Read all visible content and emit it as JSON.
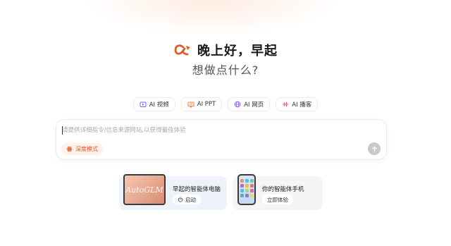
{
  "greeting": {
    "title": "晚上好，早起",
    "subtitle": "想做点什么?"
  },
  "chips": [
    {
      "icon": "video-icon",
      "label": "AI 视频"
    },
    {
      "icon": "ppt-icon",
      "label": "AI PPT"
    },
    {
      "icon": "globe-icon",
      "label": "AI 网页"
    },
    {
      "icon": "audio-wave-icon",
      "label": "AI 播客"
    }
  ],
  "input": {
    "placeholder": "请提供详细指令/信息来源网站,以获得最佳体验",
    "value": ""
  },
  "mode_button": {
    "label": "深度模式"
  },
  "cards": [
    {
      "title": "早起的智能体电脑",
      "thumb_text": "AutoGLM",
      "button": "启动"
    },
    {
      "title": "你的智能体手机",
      "button": "立即体验"
    }
  ],
  "colors": {
    "accent": "#e05a2b",
    "mode_bg": "#fdf1ec",
    "send_bg": "#c9c9c9"
  }
}
